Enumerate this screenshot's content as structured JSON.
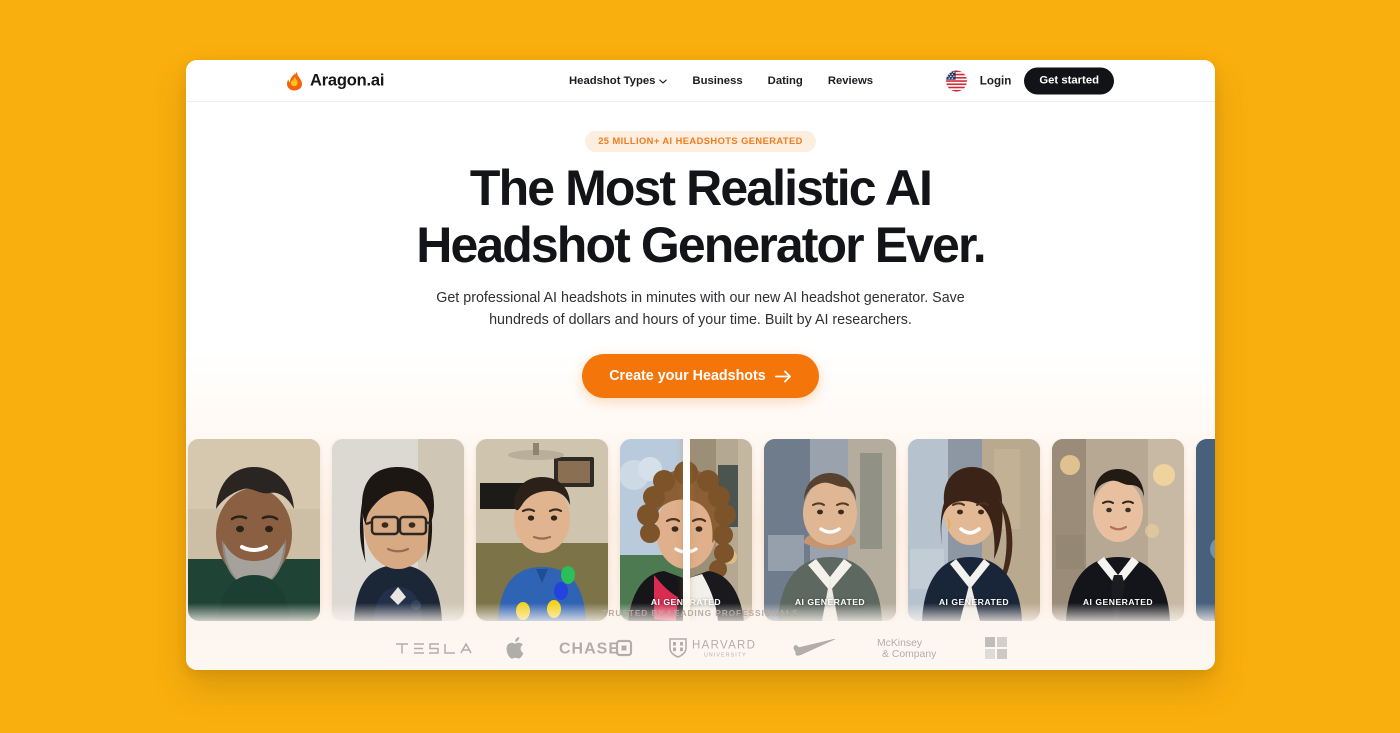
{
  "theme": {
    "page_background": "#F9AF0D",
    "accent_orange": "#F4760A",
    "badge_text_color": "#F07B1B",
    "badge_background": "#FDEEE0",
    "dark_button": "#121316",
    "heading_color": "#131417"
  },
  "header": {
    "brand": {
      "icon": "flame-icon",
      "name": "Aragon.ai"
    },
    "nav": [
      {
        "label": "Headshot Types",
        "has_dropdown": true,
        "icon": "chevron-down-icon"
      },
      {
        "label": "Business",
        "has_dropdown": false
      },
      {
        "label": "Dating",
        "has_dropdown": false
      },
      {
        "label": "Reviews",
        "has_dropdown": false
      }
    ],
    "locale_icon": "us-flag-icon",
    "login_label": "Login",
    "get_started_label": "Get started"
  },
  "hero": {
    "badge": "25 MILLION+ AI HEADSHOTS GENERATED",
    "headline_line1": "The Most Realistic AI",
    "headline_line2": "Headshot Generator Ever.",
    "subhead_line1": "Get professional AI headshots in minutes with our new AI headshot generator. Save",
    "subhead_line2": "hundreds of dollars and hours of your time. Built by AI researchers.",
    "cta_label": "Create your Headshots",
    "cta_icon": "arrow-right-icon"
  },
  "carousel": {
    "ai_generated_label": "AI GENERATED",
    "items": [
      {
        "kind": "before",
        "subject": "bearded-man-green-shirt",
        "ai_generated": false
      },
      {
        "kind": "before",
        "subject": "woman-glasses-navy-polo",
        "ai_generated": false
      },
      {
        "kind": "before",
        "subject": "man-blue-fleece-living-room",
        "ai_generated": false
      },
      {
        "kind": "before-after-split",
        "subject": "curly-hair-woman-graduation-to-headshot",
        "ai_generated": true,
        "split_position_percent": 50
      },
      {
        "kind": "after",
        "subject": "man-grey-suit-city",
        "ai_generated": true
      },
      {
        "kind": "after",
        "subject": "woman-navy-blazer-city",
        "ai_generated": true
      },
      {
        "kind": "after",
        "subject": "young-man-black-suit-tie",
        "ai_generated": true
      },
      {
        "kind": "after",
        "subject": "partial-man-navy-suit",
        "ai_generated": true
      }
    ]
  },
  "trusted_by": {
    "label": "TRUSTED BY LEADING PROFESSIONALS",
    "logos": [
      {
        "name": "tesla-logo",
        "text": "T E S L A"
      },
      {
        "name": "apple-logo",
        "text": ""
      },
      {
        "name": "chase-logo",
        "text": "CHASE"
      },
      {
        "name": "harvard-logo",
        "text": "HARVARD",
        "subtext": "UNIVERSITY"
      },
      {
        "name": "nike-logo",
        "text": ""
      },
      {
        "name": "mckinsey-logo",
        "text": "McKinsey",
        "subtext": "& Company"
      },
      {
        "name": "microsoft-logo",
        "text": ""
      }
    ]
  }
}
